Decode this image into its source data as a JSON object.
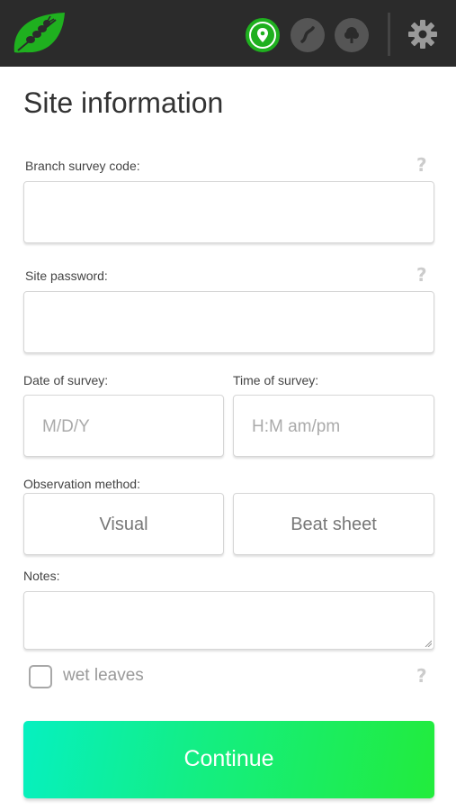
{
  "header": {
    "logo_icon": "leaf-caterpillar-icon",
    "steps": [
      {
        "icon": "location-pin-icon",
        "state": "active"
      },
      {
        "icon": "caterpillar-icon",
        "state": "inactive"
      },
      {
        "icon": "tree-icon",
        "state": "inactive"
      }
    ],
    "settings_icon": "gear-icon"
  },
  "title": "Site information",
  "fields": {
    "branch_code": {
      "label": "Branch survey code:",
      "value": "",
      "help": "?"
    },
    "site_password": {
      "label": "Site password:",
      "value": "",
      "help": "?"
    },
    "date": {
      "label": "Date of survey:",
      "placeholder": "M/D/Y"
    },
    "time": {
      "label": "Time of survey:",
      "placeholder": "H:M am/pm"
    },
    "observation_method": {
      "label": "Observation method:",
      "options": [
        "Visual",
        "Beat sheet"
      ]
    },
    "notes": {
      "label": "Notes:",
      "value": ""
    },
    "wet_leaves": {
      "label": "wet leaves",
      "checked": false,
      "help": "?"
    }
  },
  "continue_label": "Continue",
  "colors": {
    "header_bg": "#2b2b2b",
    "accent_green": "#1fb01f",
    "button_gradient_start": "#06f0c0",
    "button_gradient_end": "#22ec3c"
  }
}
